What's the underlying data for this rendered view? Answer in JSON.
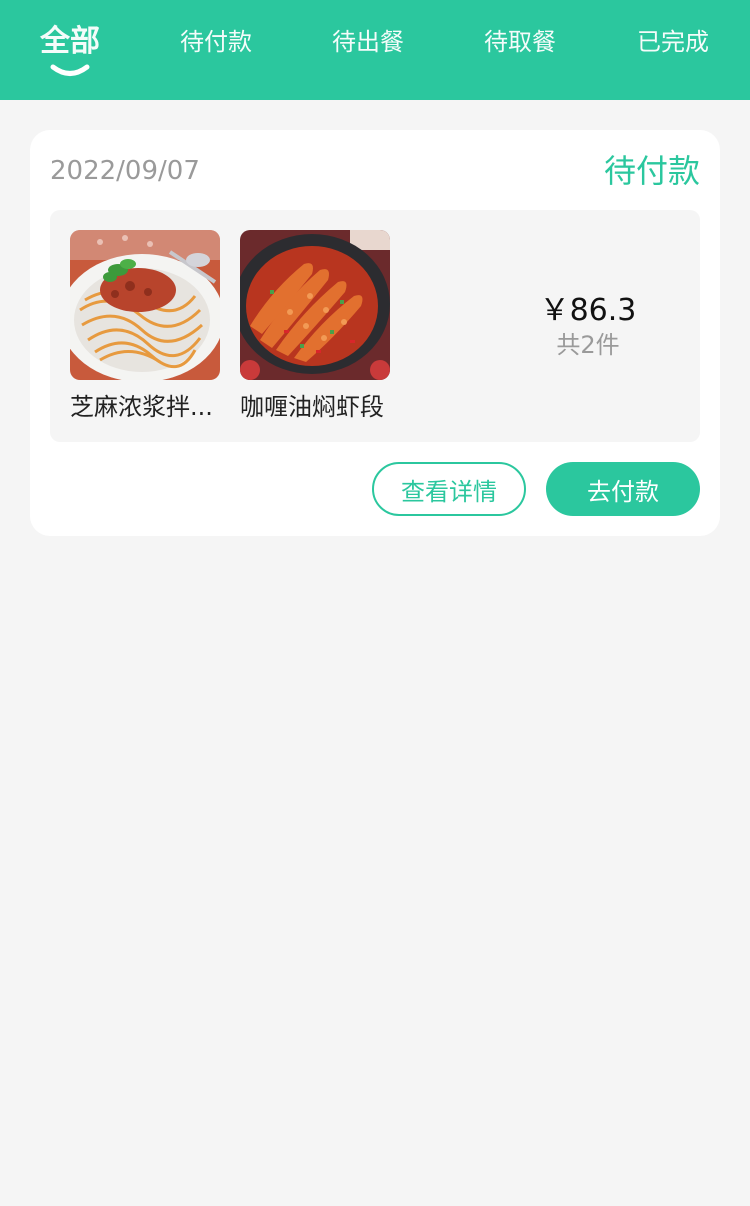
{
  "tabs": [
    {
      "label": "全部",
      "active": true
    },
    {
      "label": "待付款",
      "active": false
    },
    {
      "label": "待出餐",
      "active": false
    },
    {
      "label": "待取餐",
      "active": false
    },
    {
      "label": "已完成",
      "active": false
    }
  ],
  "colors": {
    "accent": "#2bc79e",
    "background": "#f5f5f5"
  },
  "order": {
    "date": "2022/09/07",
    "status": "待付款",
    "items": [
      {
        "name": "芝麻浓浆拌...",
        "image": "spaghetti-photo"
      },
      {
        "name": "咖喱油焖虾段",
        "image": "shrimp-dish-photo"
      }
    ],
    "price": "￥86.3",
    "count": "共2件",
    "detail_button": "查看详情",
    "pay_button": "去付款"
  }
}
